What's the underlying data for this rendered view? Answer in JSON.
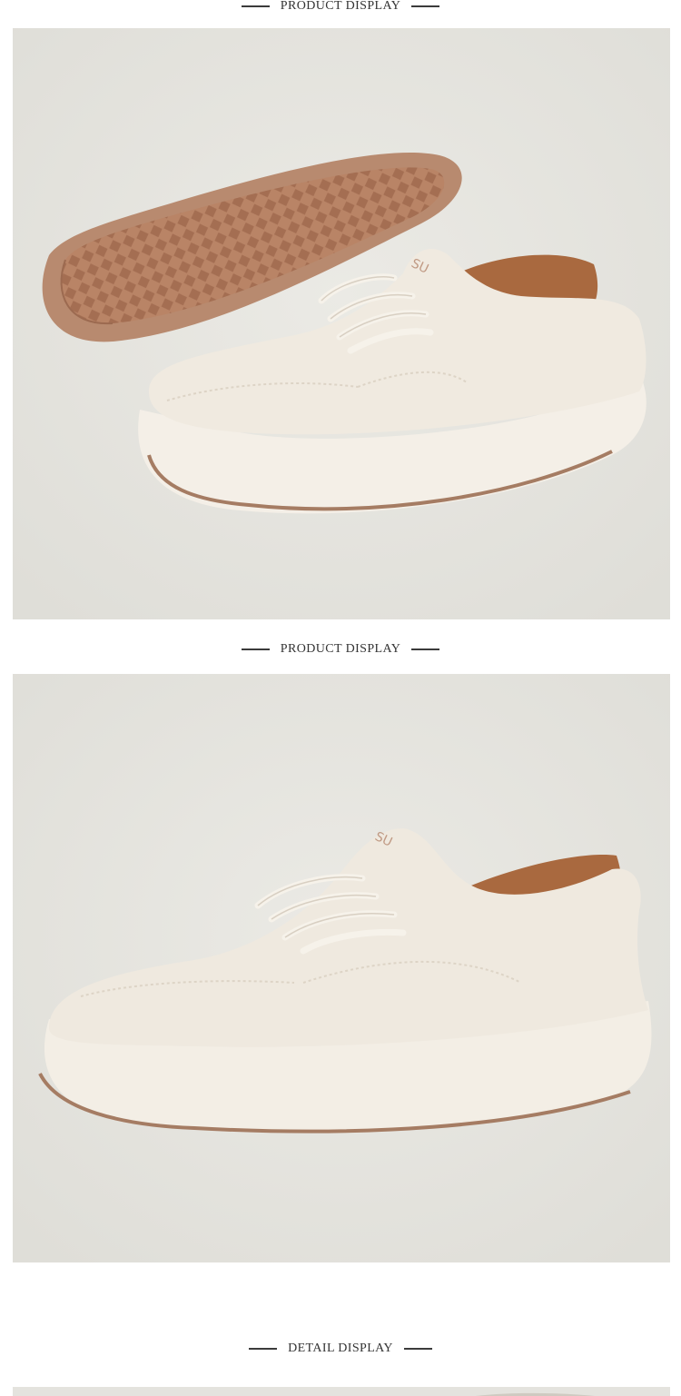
{
  "sections": [
    {
      "title": "PRODUCT DISPLAY"
    },
    {
      "title": "PRODUCT DISPLAY"
    },
    {
      "title": "DETAIL DISPLAY"
    }
  ],
  "images": [
    {
      "alt": "Cream lace-up sneaker shown with tan waffle outsole",
      "brand_mark": "SU"
    },
    {
      "alt": "Cream lace-up sneaker side view",
      "brand_mark": "SU"
    },
    {
      "alt": "Detail photo"
    }
  ],
  "colors": {
    "background": "#ffffff",
    "photo_bg": "#e6e5e0",
    "shoe_upper": "#efe9df",
    "sole": "#f3eee6",
    "outsole_tan": "#b57f62",
    "lining_brown": "#a5623a",
    "title_text": "#333333"
  }
}
